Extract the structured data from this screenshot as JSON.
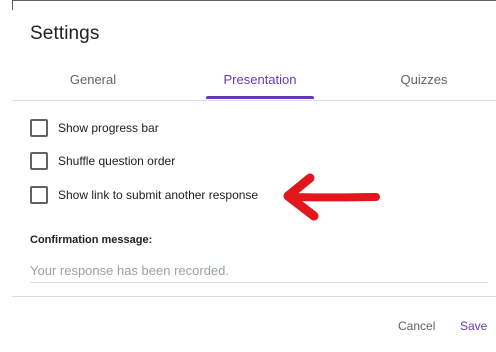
{
  "dialog": {
    "title": "Settings"
  },
  "tabs": [
    {
      "label": "General",
      "active": false
    },
    {
      "label": "Presentation",
      "active": true
    },
    {
      "label": "Quizzes",
      "active": false
    }
  ],
  "options": [
    {
      "label": "Show progress bar",
      "checked": false
    },
    {
      "label": "Shuffle question order",
      "checked": false
    },
    {
      "label": "Show link to submit another response",
      "checked": false
    }
  ],
  "confirmation": {
    "label": "Confirmation message:",
    "placeholder": "Your response has been recorded.",
    "value": ""
  },
  "footer": {
    "cancel_label": "Cancel",
    "save_label": "Save"
  },
  "colors": {
    "accent": "#673ab7",
    "annotation_arrow": "#e3161b"
  },
  "annotation": {
    "icon": "red-arrow-icon"
  }
}
